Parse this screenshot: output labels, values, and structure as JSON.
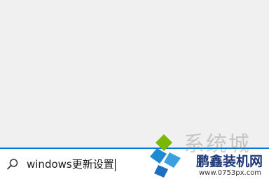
{
  "search": {
    "query": "windows更新设置",
    "icon": "search-icon"
  },
  "watermark": {
    "top_text": "系统城",
    "title": "鹏鑫装机网",
    "url": "www.0753px.com"
  },
  "colors": {
    "background": "#f0f0f0",
    "search_bar": "#ffffff",
    "accent": "#0078d7",
    "logo_green": "#7ab800",
    "logo_blue": "#1e8ad6",
    "brand_navy": "#1e3a78"
  }
}
